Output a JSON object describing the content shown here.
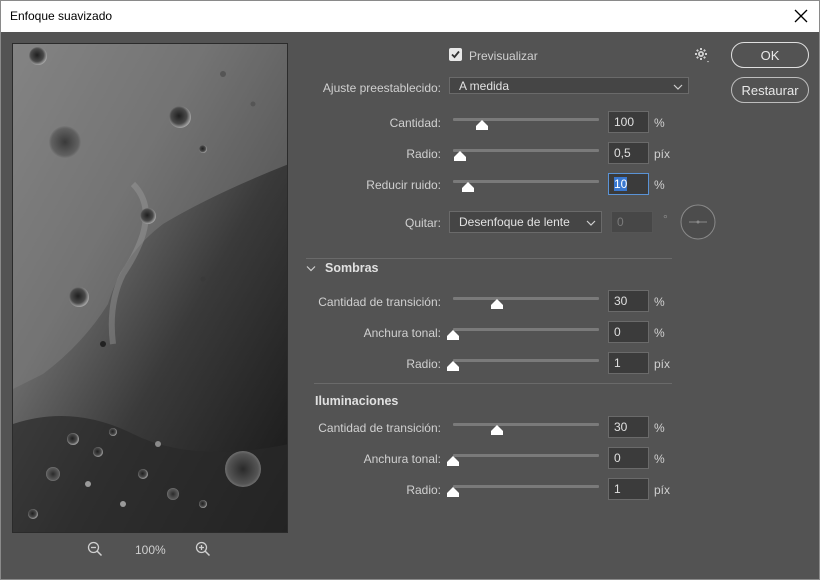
{
  "window": {
    "title": "Enfoque suavizado"
  },
  "preview_toggle": {
    "label": "Previsualizar",
    "checked": true
  },
  "buttons": {
    "ok": "OK",
    "reset": "Restaurar"
  },
  "preset": {
    "label": "Ajuste preestablecido:",
    "value": "A medida"
  },
  "main": {
    "amount": {
      "label": "Cantidad:",
      "value": "100",
      "unit": "%",
      "level": 0.2
    },
    "radius": {
      "label": "Radio:",
      "value": "0,5",
      "unit": "píx",
      "level": 0.05
    },
    "noise": {
      "label": "Reducir ruido:",
      "value": "10",
      "unit": "%",
      "level": 0.1
    },
    "remove": {
      "label": "Quitar:",
      "value": "Desenfoque de lente",
      "angle": "0",
      "angle_unit": "°"
    }
  },
  "shadows": {
    "title": "Sombras",
    "fade": {
      "label": "Cantidad de transición:",
      "value": "30",
      "unit": "%",
      "level": 0.3
    },
    "tonal": {
      "label": "Anchura tonal:",
      "value": "0",
      "unit": "%",
      "level": 0.0
    },
    "radius": {
      "label": "Radio:",
      "value": "1",
      "unit": "píx",
      "level": 0.0
    }
  },
  "highlights": {
    "title": "Iluminaciones",
    "fade": {
      "label": "Cantidad de transición:",
      "value": "30",
      "unit": "%",
      "level": 0.3
    },
    "tonal": {
      "label": "Anchura tonal:",
      "value": "0",
      "unit": "%",
      "level": 0.0
    },
    "radius": {
      "label": "Radio:",
      "value": "1",
      "unit": "píx",
      "level": 0.0
    }
  },
  "zoom": {
    "value": "100%"
  },
  "colors": {
    "background": "#535353",
    "focus": "#3a78d0"
  }
}
